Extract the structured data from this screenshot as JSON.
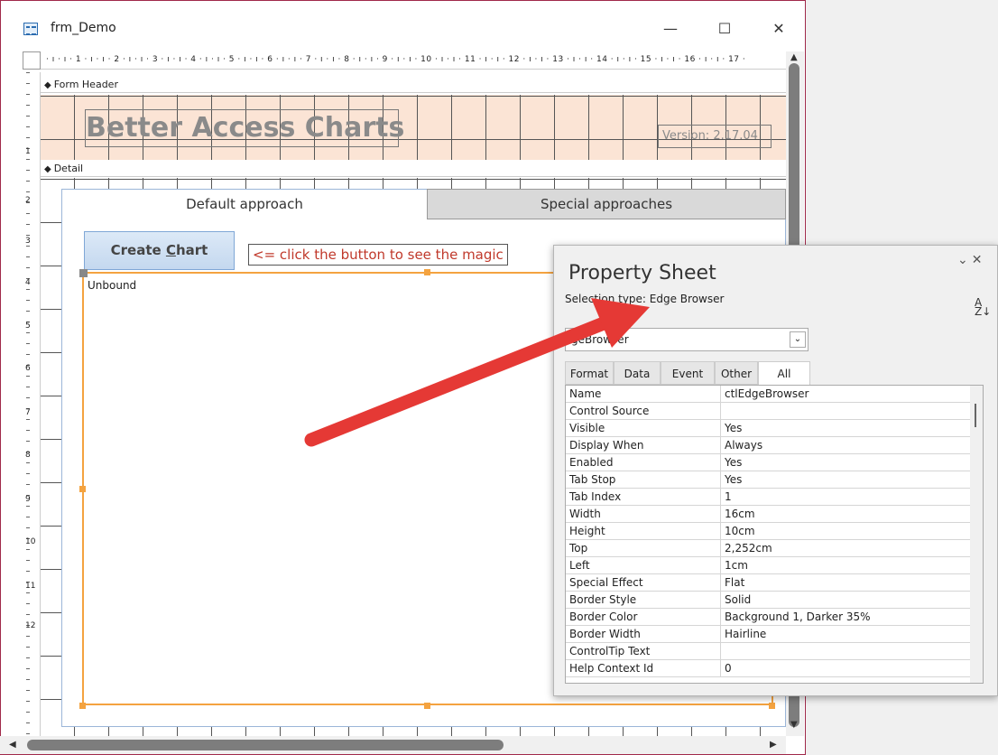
{
  "window": {
    "title": "frm_Demo",
    "minimize": "—",
    "maximize": "☐",
    "close": "✕"
  },
  "sections": {
    "form_header": "Form Header",
    "detail": "Detail"
  },
  "ruler": {
    "horizontal": "· ı · ı · 1 · ı · ı · 2 · ı · ı · 3 · ı · ı · 4 · ı · ı · 5 · ı · ı · 6 · ı · ı · 7 · ı · ı · 8 · ı · ı · 9 · ı · ı · 10 · ı · ı · 11 · ı · ı · 12 · ı · ı · 13 · ı · ı · 14 · ı · ı · 15 · ı · ı · 16 · ı · ı · 17 ·",
    "vertical": [
      "1",
      "2",
      "3",
      "4",
      "5",
      "6",
      "7",
      "8",
      "9",
      "10",
      "11",
      "12"
    ]
  },
  "header": {
    "title": "Better Access Charts",
    "version": "Version: 2.17.04"
  },
  "tabs": [
    "Default approach",
    "Special approaches"
  ],
  "create_button": {
    "prefix": "Create ",
    "hotkey": "C",
    "suffix": "hart"
  },
  "hint": "<= click the button to see the magic",
  "browser": {
    "label": "Unbound"
  },
  "property_sheet": {
    "title": "Property Sheet",
    "selection_type": "Selection type:  Edge Browser",
    "control_name": "ctlEdgeBrowser",
    "combo_visible": "geBrowser",
    "tabs": [
      "Format",
      "Data",
      "Event",
      "Other",
      "All"
    ],
    "active_tab": "All",
    "properties": [
      {
        "name": "Name",
        "value": "ctlEdgeBrowser"
      },
      {
        "name": "Control Source",
        "value": ""
      },
      {
        "name": "Visible",
        "value": "Yes"
      },
      {
        "name": "Display When",
        "value": "Always"
      },
      {
        "name": "Enabled",
        "value": "Yes"
      },
      {
        "name": "Tab Stop",
        "value": "Yes"
      },
      {
        "name": "Tab Index",
        "value": "1"
      },
      {
        "name": "Width",
        "value": "16cm"
      },
      {
        "name": "Height",
        "value": "10cm"
      },
      {
        "name": "Top",
        "value": "2,252cm"
      },
      {
        "name": "Left",
        "value": "1cm"
      },
      {
        "name": "Special Effect",
        "value": "Flat"
      },
      {
        "name": "Border Style",
        "value": "Solid"
      },
      {
        "name": "Border Color",
        "value": "Background 1, Darker 35%"
      },
      {
        "name": "Border Width",
        "value": "Hairline"
      },
      {
        "name": "ControlTip Text",
        "value": ""
      },
      {
        "name": "Help Context Id",
        "value": "0"
      }
    ]
  },
  "colors": {
    "header_bg": "#fbe4d5",
    "selection": "#f4a340",
    "hint_text": "#c0392b",
    "arrow": "#e53935"
  }
}
